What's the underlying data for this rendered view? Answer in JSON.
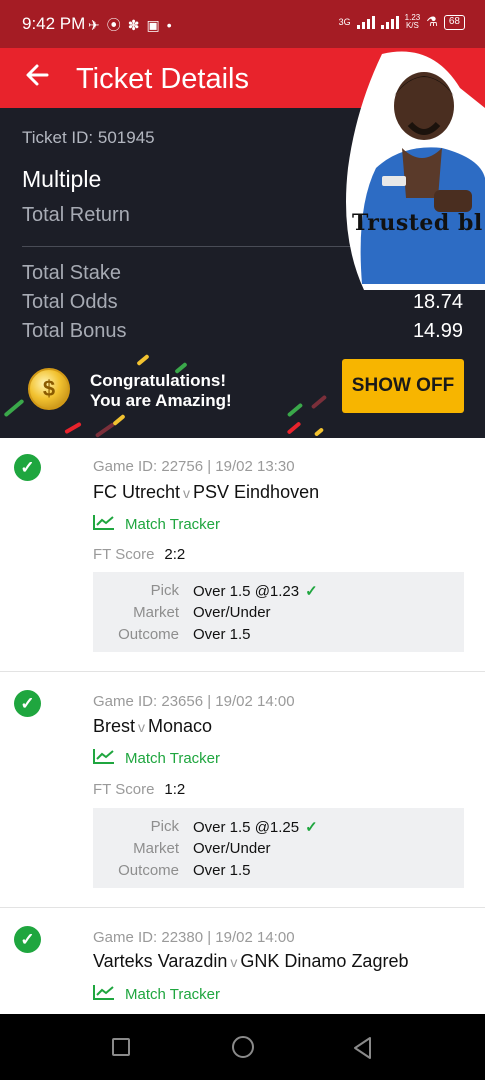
{
  "status_bar": {
    "time": "9:42 PM",
    "network": "3G",
    "speed_value": "1.23",
    "speed_unit": "K/S",
    "battery": "68"
  },
  "app_bar": {
    "title": "Ticket Details",
    "back_icon": "arrow-left-icon"
  },
  "summary": {
    "ticket_id": "Ticket ID: 501945",
    "bet_type": "Multiple",
    "total_return_label": "Total Return",
    "total_stake_label": "Total Stake",
    "total_odds_label": "Total Odds",
    "total_odds_value": "18.74",
    "total_bonus_label": "Total Bonus",
    "total_bonus_value": "14.99"
  },
  "sticker": {
    "text": "Trusted bl"
  },
  "banner": {
    "line1": "Congratulations!",
    "line2": "You are Amazing!",
    "coin_symbol": "$",
    "button": "SHOW OFF"
  },
  "games": [
    {
      "id_line": "Game ID: 22756 | 19/02 13:30",
      "home": "FC Utrecht",
      "vs": "v",
      "away": "PSV Eindhoven",
      "tracker": "Match Tracker",
      "ft_label": "FT Score",
      "ft_value": "2:2",
      "pick_label": "Pick",
      "pick_value": "Over 1.5 @1.23",
      "market_label": "Market",
      "market_value": "Over/Under",
      "outcome_label": "Outcome",
      "outcome_value": "Over 1.5"
    },
    {
      "id_line": "Game ID: 23656 | 19/02 14:00",
      "home": "Brest",
      "vs": "v",
      "away": "Monaco",
      "tracker": "Match Tracker",
      "ft_label": "FT Score",
      "ft_value": "1:2",
      "pick_label": "Pick",
      "pick_value": "Over 1.5 @1.25",
      "market_label": "Market",
      "market_value": "Over/Under",
      "outcome_label": "Outcome",
      "outcome_value": "Over 1.5"
    },
    {
      "id_line": "Game ID: 22380 | 19/02 14:00",
      "home": "Varteks Varazdin",
      "vs": "v",
      "away": "GNK Dinamo Zagreb",
      "tracker": "Match Tracker"
    }
  ],
  "colors": {
    "brand_red": "#e8232c",
    "status_red": "#a51c24",
    "dark_panel": "#1c1e27",
    "win_green": "#1fa63f",
    "show_off_yellow": "#f7b500"
  }
}
